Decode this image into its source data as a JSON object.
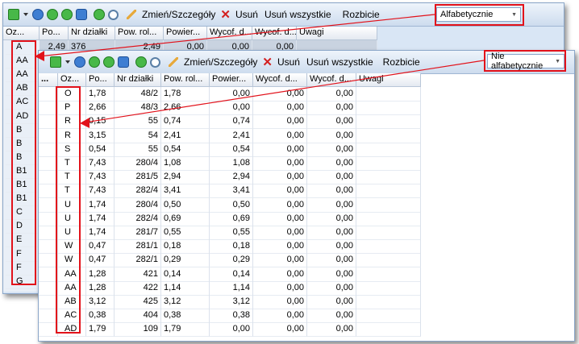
{
  "toolbar": {
    "edit_label": "Zmień/Szczegóły",
    "delete_label": "Usuń",
    "delete_all_label": "Usuń wszystkie",
    "split_label": "Rozbicie"
  },
  "back_window": {
    "sort_select": "Alfabetycznie",
    "columns": [
      "Oz...",
      "Po...",
      "Nr działki",
      "Pow. rol...",
      "Powier...",
      "Wycof. d...",
      "Wycof. d...",
      "Uwagi"
    ],
    "first_row": [
      "A",
      "2,49",
      "376",
      "2,49",
      "0,00",
      "0,00",
      "0,00",
      ""
    ],
    "left_values": [
      "A",
      "AA",
      "AA",
      "AB",
      "AC",
      "AD",
      "B",
      "B",
      "B",
      "B1",
      "B1",
      "B1",
      "C",
      "D",
      "E",
      "F",
      "F",
      "G"
    ]
  },
  "front_window": {
    "sort_select": "Nie alfabetycznie",
    "columns": [
      "...",
      "Oz...",
      "Po...",
      "Nr działki",
      "Pow. rol...",
      "Powier...",
      "Wycof. d...",
      "Wycof. d...",
      "Uwagi"
    ],
    "rows": [
      [
        "O",
        "1,78",
        "48/2",
        "1,78",
        "0,00",
        "0,00",
        "0,00"
      ],
      [
        "P",
        "2,66",
        "48/3",
        "2,66",
        "0,00",
        "0,00",
        "0,00"
      ],
      [
        "R",
        "0,15",
        "55",
        "0,74",
        "0,74",
        "0,00",
        "0,00"
      ],
      [
        "R",
        "3,15",
        "54",
        "2,41",
        "2,41",
        "0,00",
        "0,00"
      ],
      [
        "S",
        "0,54",
        "55",
        "0,54",
        "0,54",
        "0,00",
        "0,00"
      ],
      [
        "T",
        "7,43",
        "280/4",
        "1,08",
        "1,08",
        "0,00",
        "0,00"
      ],
      [
        "T",
        "7,43",
        "281/5",
        "2,94",
        "2,94",
        "0,00",
        "0,00"
      ],
      [
        "T",
        "7,43",
        "282/4",
        "3,41",
        "3,41",
        "0,00",
        "0,00"
      ],
      [
        "U",
        "1,74",
        "280/4",
        "0,50",
        "0,50",
        "0,00",
        "0,00"
      ],
      [
        "U",
        "1,74",
        "282/4",
        "0,69",
        "0,69",
        "0,00",
        "0,00"
      ],
      [
        "U",
        "1,74",
        "281/7",
        "0,55",
        "0,55",
        "0,00",
        "0,00"
      ],
      [
        "W",
        "0,47",
        "281/1",
        "0,18",
        "0,18",
        "0,00",
        "0,00"
      ],
      [
        "W",
        "0,47",
        "282/1",
        "0,29",
        "0,29",
        "0,00",
        "0,00"
      ],
      [
        "AA",
        "1,28",
        "421",
        "0,14",
        "0,14",
        "0,00",
        "0,00"
      ],
      [
        "AA",
        "1,28",
        "422",
        "1,14",
        "1,14",
        "0,00",
        "0,00"
      ],
      [
        "AB",
        "3,12",
        "425",
        "3,12",
        "3,12",
        "0,00",
        "0,00"
      ],
      [
        "AC",
        "0,38",
        "404",
        "0,38",
        "0,38",
        "0,00",
        "0,00"
      ],
      [
        "AD",
        "1,79",
        "109",
        "1,79",
        "0,00",
        "0,00",
        "0,00"
      ]
    ]
  },
  "colors": {
    "highlight_box": "#e2111a",
    "window_bg": "#d9e6f5"
  }
}
